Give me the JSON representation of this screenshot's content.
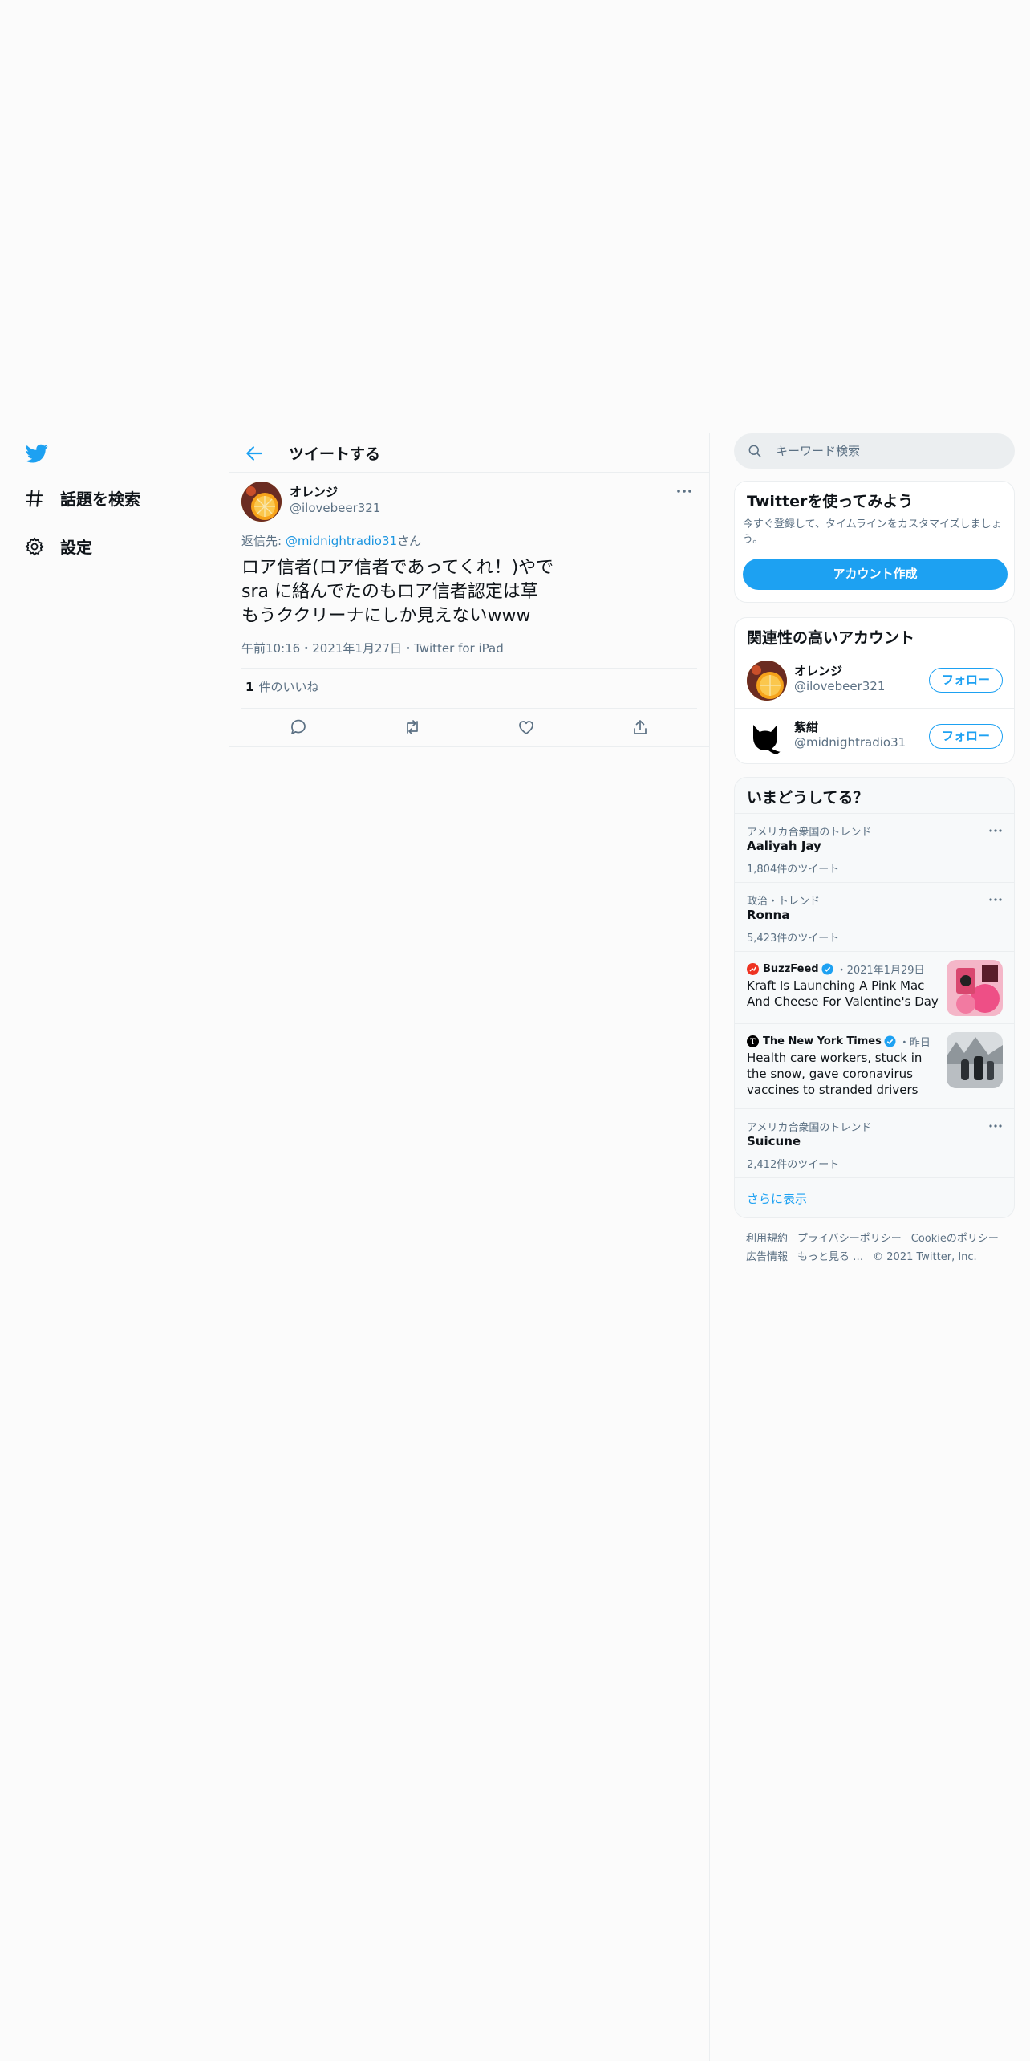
{
  "nav": {
    "items": [
      {
        "label": "話題を検索",
        "icon": "hashtag-icon"
      },
      {
        "label": "設定",
        "icon": "gear-icon"
      }
    ]
  },
  "header": {
    "title": "ツイートする"
  },
  "tweet": {
    "author_name": "オレンジ",
    "author_handle": "@ilovebeer321",
    "reply_prefix": "返信先: ",
    "reply_mention": "@midnightradio31",
    "reply_suffix": "さん",
    "text": "ロア信者(ロア信者であってくれ！)やで\nsra に絡んでたのもロア信者認定は草\nもうククリーナにしか見えないwww",
    "meta": "午前10:16・2021年1月27日・Twitter for iPad",
    "like_count": "1",
    "like_label": "件のいいね"
  },
  "search": {
    "placeholder": "キーワード検索"
  },
  "signup": {
    "title": "Twitterを使ってみよう",
    "subtitle": "今すぐ登録して、タイムラインをカスタマイズしましょう。",
    "button": "アカウント作成"
  },
  "relevant": {
    "title": "関連性の高いアカウント",
    "follow_label": "フォロー",
    "accounts": [
      {
        "name": "オレンジ",
        "handle": "@ilovebeer321"
      },
      {
        "name": "紫紺",
        "handle": "@midnightradio31"
      }
    ]
  },
  "trends": {
    "title": "いまどうしてる？",
    "items": [
      {
        "context": "アメリカ合衆国のトレンド",
        "title": "Aaliyah Jay",
        "count": "1,804件のツイート"
      },
      {
        "context": "政治・トレンド",
        "title": "Ronna",
        "count": "5,423件のツイート"
      },
      {
        "context": "アメリカ合衆国のトレンド",
        "title": "Suicune",
        "count": "2,412件のツイート"
      }
    ],
    "news": [
      {
        "publisher": "BuzzFeed",
        "when": "・2021年1月29日",
        "headline": "Kraft Is Launching A Pink Mac And Cheese For Valentine's Day"
      },
      {
        "publisher": "The New York Times",
        "when": "・昨日",
        "headline": "Health care workers, stuck in the snow, gave coronavirus vaccines to stranded drivers"
      }
    ],
    "show_more": "さらに表示"
  },
  "footer": {
    "links": [
      "利用規約",
      "プライバシーポリシー",
      "Cookieのポリシー",
      "広告情報",
      "もっと見る …",
      "© 2021 Twitter, Inc."
    ]
  },
  "colors": {
    "accent": "#1da1f2",
    "text": "#0f1419",
    "muted": "#5b7083",
    "border": "#ebeef0"
  }
}
